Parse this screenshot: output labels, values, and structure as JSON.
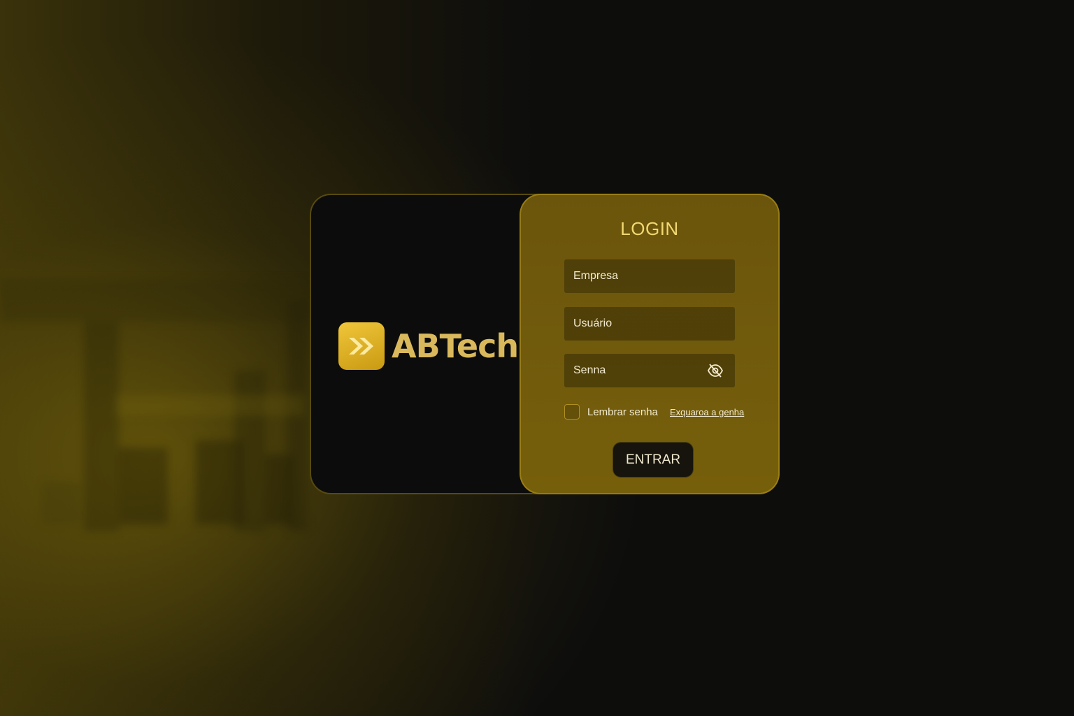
{
  "brand": {
    "name": "ABTech",
    "logo_icon": "double-chevron-right-icon"
  },
  "login": {
    "title": "LOGIN",
    "fields": {
      "company_placeholder": "Empresa",
      "user_placeholder": "Usuário",
      "password_placeholder": "Senna",
      "password_toggle_icon": "eye-off-icon"
    },
    "remember_label": "Lembrar senha",
    "forgot_link": "Exquaroa a genha",
    "submit_label": "ENTRAR"
  },
  "colors": {
    "accent_gold": "#e8bd2e",
    "panel_bg": "#6f590b",
    "card_bg": "#0c0c0c",
    "button_bg": "#16140d"
  }
}
